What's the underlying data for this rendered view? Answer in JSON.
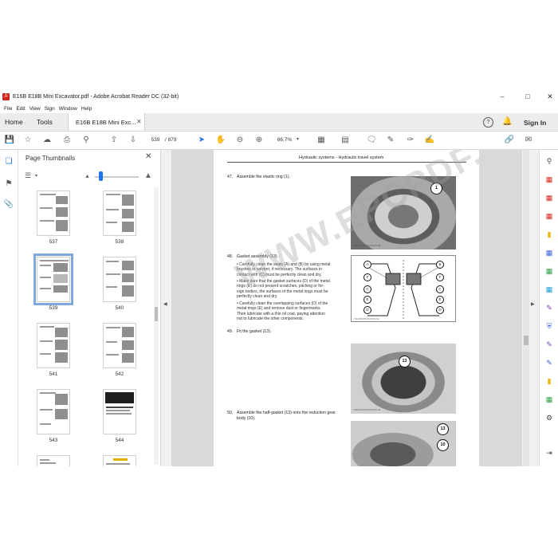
{
  "window": {
    "title": "E16B E18B Mini Excavator.pdf - Adobe Acrobat Reader DC (32-bit)",
    "pdf_badge": "A"
  },
  "menu": [
    "File",
    "Edit",
    "View",
    "Sign",
    "Window",
    "Help"
  ],
  "tabs": {
    "home": "Home",
    "tools": "Tools",
    "document": "E16B E18B Mini Exc...",
    "sign_in": "Sign In"
  },
  "toolbar": {
    "page_current": "539",
    "page_total": "/ 879",
    "zoom": "66,7%"
  },
  "thumbnails": {
    "title": "Page Thumbnails",
    "pages": [
      "537",
      "538",
      "539",
      "540",
      "541",
      "542",
      "543",
      "544"
    ],
    "selected": "539"
  },
  "document": {
    "running_head": "Hydraulic systems - Hydraulic travel system",
    "steps": [
      {
        "num": "47.",
        "text": "Assemble the elastic ring (1)."
      },
      {
        "num": "48.",
        "text": "Gasket assembly (13)."
      },
      {
        "num": "49.",
        "text": "Fit the gasket (13)."
      },
      {
        "num": "50.",
        "text": "Assemble the half-gasket (13) onto the reduction gear"
      },
      {
        "num": "",
        "text": "body (10)."
      }
    ],
    "bullets": [
      [
        "• Carefully clean the seats (A) and (B) by using metal",
        "brushes or solvent, if necessary. The surfaces in",
        "contact with (C) must be perfectly clean and dry."
      ],
      [
        "• Make sure that the gasket surfaces (D) of the metal",
        "rings (E) do not present scratches, pitching or for-",
        "eign bodies, the surfaces of the metal rings must be",
        "perfectly clean and dry."
      ],
      [
        "• Carefully clean the overlapping surfaces (D) of the",
        "metal rings (E) and remove dust or fingermarks.",
        "Then lubricate with a thin oil coat, paying attention",
        "not to lubricate the other components."
      ]
    ],
    "callouts": {
      "ring1": "1",
      "gasket": "13",
      "half_gasket": "13",
      "body": "10"
    },
    "diagram_labels": {
      "left": [
        "A",
        "F",
        "C",
        "E",
        "D"
      ],
      "right": [
        "B",
        "F",
        "C",
        "E",
        "D"
      ]
    },
    "fig_codes": [
      "TGPH1XXXXXXXXXX 90",
      "TGL9XXXXXXXXXX 91",
      "TGPH1XXXXXXXXXX 92"
    ],
    "watermark": "WWW.EPCPDF.COM"
  }
}
